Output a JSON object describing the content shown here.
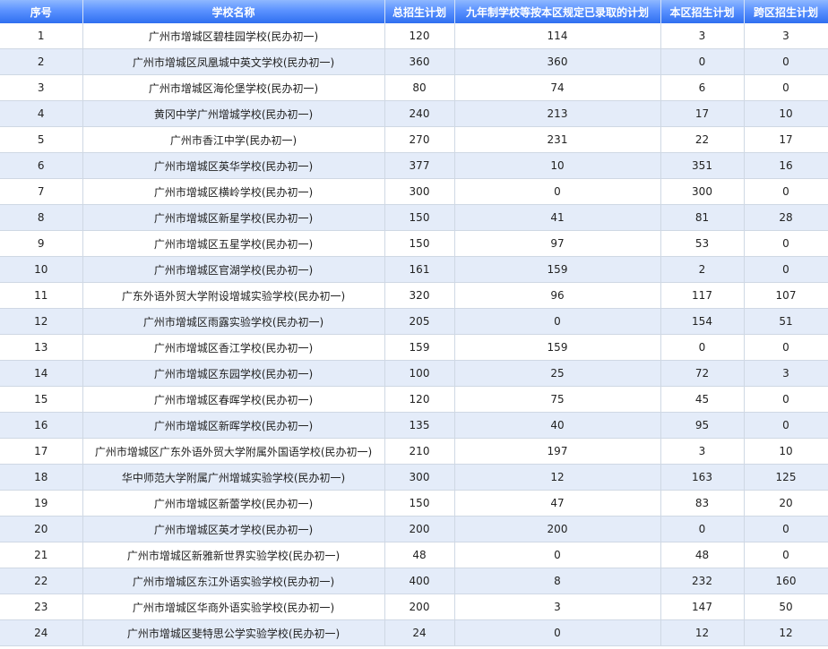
{
  "headers": [
    "序号",
    "学校名称",
    "总招生计划",
    "九年制学校等按本区规定已录取的计划",
    "本区招生计划",
    "跨区招生计划"
  ],
  "rows": [
    [
      "1",
      "广州市增城区碧桂园学校(民办初一)",
      "120",
      "114",
      "3",
      "3"
    ],
    [
      "2",
      "广州市增城区凤凰城中英文学校(民办初一)",
      "360",
      "360",
      "0",
      "0"
    ],
    [
      "3",
      "广州市增城区海伦堡学校(民办初一)",
      "80",
      "74",
      "6",
      "0"
    ],
    [
      "4",
      "黄冈中学广州增城学校(民办初一)",
      "240",
      "213",
      "17",
      "10"
    ],
    [
      "5",
      "广州市香江中学(民办初一)",
      "270",
      "231",
      "22",
      "17"
    ],
    [
      "6",
      "广州市增城区英华学校(民办初一)",
      "377",
      "10",
      "351",
      "16"
    ],
    [
      "7",
      "广州市增城区横岭学校(民办初一)",
      "300",
      "0",
      "300",
      "0"
    ],
    [
      "8",
      "广州市增城区新星学校(民办初一)",
      "150",
      "41",
      "81",
      "28"
    ],
    [
      "9",
      "广州市增城区五星学校(民办初一)",
      "150",
      "97",
      "53",
      "0"
    ],
    [
      "10",
      "广州市增城区官湖学校(民办初一)",
      "161",
      "159",
      "2",
      "0"
    ],
    [
      "11",
      "广东外语外贸大学附设增城实验学校(民办初一)",
      "320",
      "96",
      "117",
      "107"
    ],
    [
      "12",
      "广州市增城区雨露实验学校(民办初一)",
      "205",
      "0",
      "154",
      "51"
    ],
    [
      "13",
      "广州市增城区香江学校(民办初一)",
      "159",
      "159",
      "0",
      "0"
    ],
    [
      "14",
      "广州市增城区东园学校(民办初一)",
      "100",
      "25",
      "72",
      "3"
    ],
    [
      "15",
      "广州市增城区春晖学校(民办初一)",
      "120",
      "75",
      "45",
      "0"
    ],
    [
      "16",
      "广州市增城区新晖学校(民办初一)",
      "135",
      "40",
      "95",
      "0"
    ],
    [
      "17",
      "广州市增城区广东外语外贸大学附属外国语学校(民办初一)",
      "210",
      "197",
      "3",
      "10"
    ],
    [
      "18",
      "华中师范大学附属广州增城实验学校(民办初一)",
      "300",
      "12",
      "163",
      "125"
    ],
    [
      "19",
      "广州市增城区新蕾学校(民办初一)",
      "150",
      "47",
      "83",
      "20"
    ],
    [
      "20",
      "广州市增城区英才学校(民办初一)",
      "200",
      "200",
      "0",
      "0"
    ],
    [
      "21",
      "广州市增城区新雅新世界实验学校(民办初一)",
      "48",
      "0",
      "48",
      "0"
    ],
    [
      "22",
      "广州市增城区东江外语实验学校(民办初一)",
      "400",
      "8",
      "232",
      "160"
    ],
    [
      "23",
      "广州市增城区华商外语实验学校(民办初一)",
      "200",
      "3",
      "147",
      "50"
    ],
    [
      "24",
      "广州市增城区斐特思公学实验学校(民办初一)",
      "24",
      "0",
      "12",
      "12"
    ]
  ]
}
